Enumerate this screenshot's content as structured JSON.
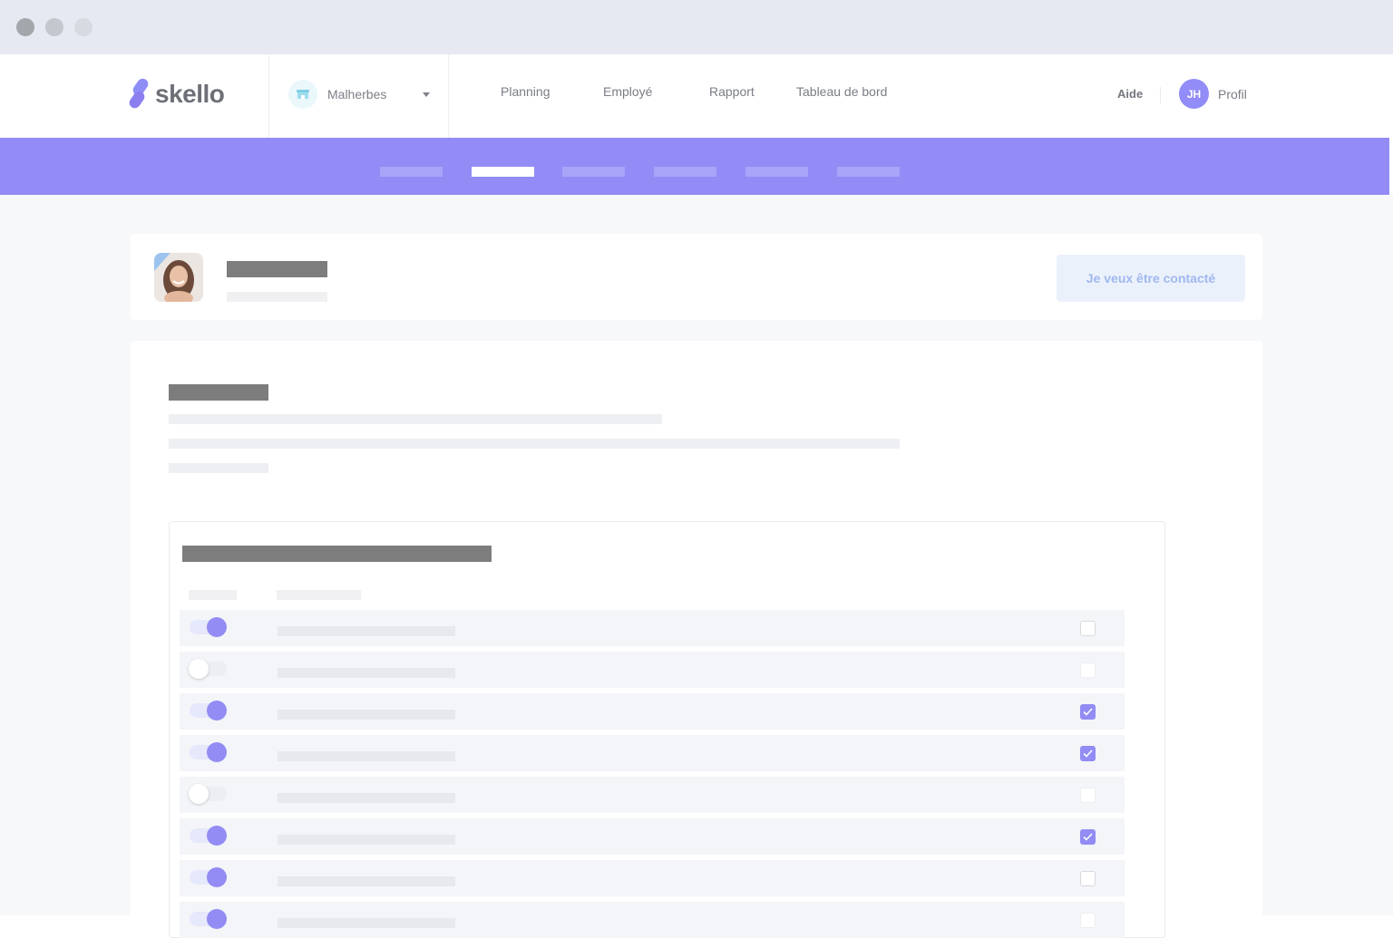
{
  "app": {
    "brand": "skello"
  },
  "nav": {
    "shop_name": "Malherbes",
    "links": [
      "Planning",
      "Employé",
      "Rapport",
      "Tableau de bord"
    ],
    "help": "Aide",
    "avatar_initials": "JH",
    "profile": "Profil"
  },
  "subnav": {
    "active_index": 1,
    "tab_count": 6
  },
  "profile_card": {
    "contact_button": "Je veux être contacté"
  },
  "settings_list": {
    "rows": [
      {
        "toggle": "on",
        "checkbox": "unchecked"
      },
      {
        "toggle": "off",
        "checkbox": "disabled"
      },
      {
        "toggle": "on",
        "checkbox": "checked"
      },
      {
        "toggle": "on",
        "checkbox": "checked"
      },
      {
        "toggle": "off",
        "checkbox": "disabled"
      },
      {
        "toggle": "on",
        "checkbox": "checked"
      },
      {
        "toggle": "on",
        "checkbox": "unchecked"
      },
      {
        "toggle": "on",
        "checkbox": "disabled"
      }
    ]
  },
  "colors": {
    "accent": "#938cf6",
    "brand_purple": "#928cf4",
    "contact_button_bg": "#ebf1fb",
    "contact_button_text": "#9fb8ef"
  },
  "icons": [
    "window-close-dot",
    "window-minimize-dot",
    "window-zoom-dot",
    "skello-logo-mark",
    "shop-icon",
    "chevron-down-icon",
    "profile-photo",
    "toggle-switch",
    "checkbox",
    "check-icon"
  ]
}
